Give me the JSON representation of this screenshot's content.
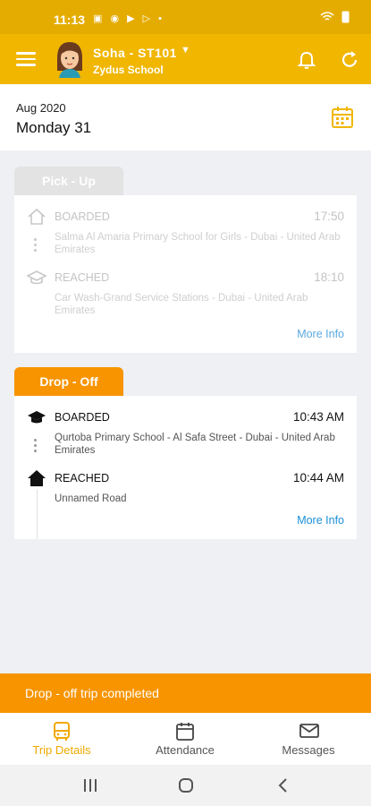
{
  "status_bar": {
    "time": "11:13",
    "icons": [
      "image-icon",
      "whatsapp-icon",
      "youtube-icon",
      "play-icon",
      "dot-icon"
    ],
    "system": "wifi battery"
  },
  "header": {
    "user_name": "Soha  -  ST101",
    "school": "Zydus School"
  },
  "date": {
    "month_year": "Aug 2020",
    "day": "Monday 31"
  },
  "pickup": {
    "tab_label": "Pick - Up",
    "boarded": {
      "status": "BOARDED",
      "time": "17:50",
      "address": "Salma Al Amaria Primary School for Girls - Dubai - United Arab Emirates"
    },
    "reached": {
      "status": "REACHED",
      "time": "18:10",
      "address": "Car Wash-Grand Service Stations - Dubai - United Arab Emirates"
    },
    "more_info": "More Info"
  },
  "dropoff": {
    "tab_label": "Drop - Off",
    "boarded": {
      "status": "BOARDED",
      "time": "10:43 AM",
      "address": "Qurtoba Primary School - Al Safa Street - Dubai - United Arab Emirates"
    },
    "reached": {
      "status": "REACHED",
      "time": "10:44 AM",
      "address": "Unnamed Road"
    },
    "more_info": "More Info"
  },
  "banner": {
    "text": "Drop - off trip completed"
  },
  "bottom_nav": [
    {
      "label": "Trip Details",
      "icon": "bus-icon",
      "active": true
    },
    {
      "label": "Attendance",
      "icon": "calendar-icon",
      "active": false
    },
    {
      "label": "Messages",
      "icon": "envelope-icon",
      "active": false
    }
  ],
  "colors": {
    "primary": "#f0b600",
    "accent": "#f79400",
    "link": "#1a8fd8"
  }
}
